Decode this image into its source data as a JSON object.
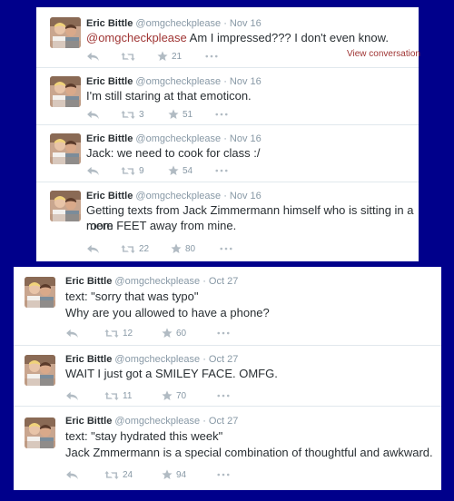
{
  "panel1": {
    "tweets": [
      {
        "name": "Eric Bittle",
        "handle": "@omgcheckplease",
        "date": "Nov 16",
        "mention": "@omgcheckplease",
        "text": " Am I impressed??? I don't even know.",
        "retweets": "",
        "favorites": "21",
        "view_conversation": "View conversation"
      },
      {
        "name": "Eric Bittle",
        "handle": "@omgcheckplease",
        "date": "Nov 16",
        "text": "I'm still staring at that emoticon.",
        "retweets": "3",
        "favorites": "51"
      },
      {
        "name": "Eric Bittle",
        "handle": "@omgcheckplease",
        "date": "Nov 16",
        "text": "Jack: we need to cook for class :/",
        "retweets": "9",
        "favorites": "54"
      },
      {
        "name": "Eric Bittle",
        "handle": "@omgcheckplease",
        "date": "Nov 16",
        "text_line1": "Getting texts from Jack Zimmermann himself who is sitting in a room",
        "text_line2": "mere FEET away from mine.",
        "retweets": "22",
        "favorites": "80"
      }
    ]
  },
  "panel2": {
    "tweets": [
      {
        "name": "Eric Bittle",
        "handle": "@omgcheckplease",
        "date": "Oct 27",
        "text_line1": "text: \"sorry that was typo\"",
        "text_line2": "Why are you allowed to have a phone?",
        "retweets": "12",
        "favorites": "60"
      },
      {
        "name": "Eric Bittle",
        "handle": "@omgcheckplease",
        "date": "Oct 27",
        "text": "WAIT I just got a SMILEY FACE. OMFG.",
        "retweets": "11",
        "favorites": "70"
      },
      {
        "name": "Eric Bittle",
        "handle": "@omgcheckplease",
        "date": "Oct 27",
        "text_line1": "text: \"stay hydrated this week\"",
        "text_line2": "Jack Zmmermann is a special combination of thoughtful and awkward.",
        "retweets": "24",
        "favorites": "94"
      }
    ]
  },
  "separator": " · ",
  "icons": {
    "reply": "reply-icon",
    "retweet": "retweet-icon",
    "favorite": "star-icon",
    "more": "more-icon",
    "avatar": "avatar"
  },
  "colors": {
    "background": "#00008b",
    "link": "#9f3433",
    "muted": "#8899a6",
    "text": "#292f33"
  }
}
